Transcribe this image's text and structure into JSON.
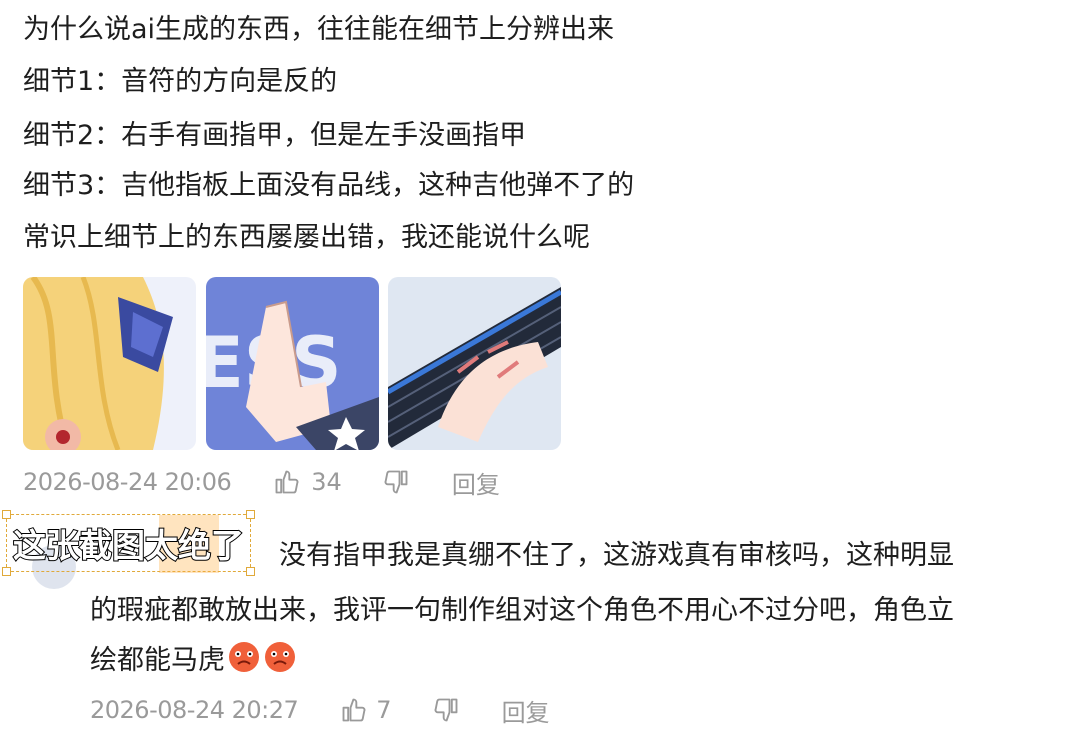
{
  "comment": {
    "lines": [
      "为什么说ai生成的东西，往往能在细节上分辨出来",
      "细节1：音符的方向是反的",
      "细节2：右手有画指甲，但是左手没画指甲",
      "细节3：吉他指板上面没有品线，这种吉他弹不了的",
      "常识上细节上的东西屡屡出错，我还能说什么呢"
    ],
    "images": [
      "hair-closeup",
      "pointing-hand",
      "guitar-fretboard"
    ],
    "timestamp": "2026-08-24 20:06",
    "likes": "34",
    "reply_label": "回复"
  },
  "reply": {
    "caption_overlay": "这张截图太绝了",
    "lines": [
      "没有指甲我是真绷不住了，这游戏真有审核吗，这种明显",
      "的瑕疵都敢放出来，我评一句制作组对这个角色不用心不过分吧，角色立",
      "绘都能马虎"
    ],
    "emoji": [
      "angry-face-emoji",
      "angry-face-emoji"
    ],
    "timestamp": "2026-08-24 20:27",
    "likes": "7",
    "reply_label": "回复"
  },
  "colors": {
    "text": "#1e1e1e",
    "meta": "#9a9a9a",
    "caption_border": "#e0a93a"
  }
}
